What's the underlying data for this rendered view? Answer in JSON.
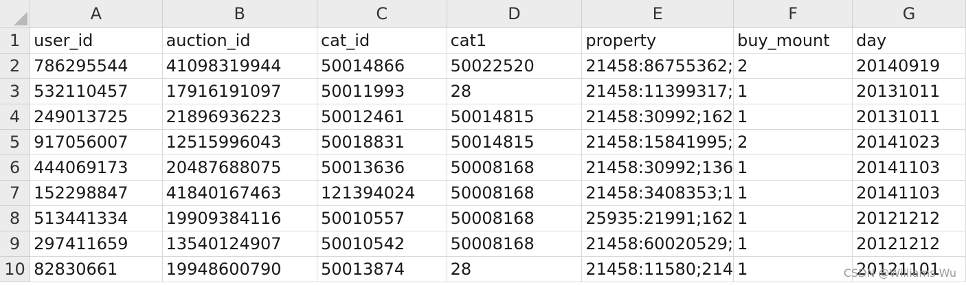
{
  "columns": [
    "A",
    "B",
    "C",
    "D",
    "E",
    "F",
    "G"
  ],
  "rows": [
    {
      "num": "1",
      "cells": [
        "user_id",
        "auction_id",
        "cat_id",
        "cat1",
        "property",
        "buy_mount",
        "day"
      ]
    },
    {
      "num": "2",
      "cells": [
        "786295544",
        "41098319944",
        "50014866",
        "50022520",
        "21458:86755362;",
        "2",
        "20140919"
      ]
    },
    {
      "num": "3",
      "cells": [
        "532110457",
        "17916191097",
        "50011993",
        "28",
        "21458:11399317;",
        "1",
        "20131011"
      ]
    },
    {
      "num": "4",
      "cells": [
        "249013725",
        "21896936223",
        "50012461",
        "50014815",
        "21458:30992;162",
        "1",
        "20131011"
      ]
    },
    {
      "num": "5",
      "cells": [
        "917056007",
        "12515996043",
        "50018831",
        "50014815",
        "21458:15841995;",
        "2",
        "20141023"
      ]
    },
    {
      "num": "6",
      "cells": [
        "444069173",
        "20487688075",
        "50013636",
        "50008168",
        "21458:30992;136",
        "1",
        "20141103"
      ]
    },
    {
      "num": "7",
      "cells": [
        "152298847",
        "41840167463",
        "121394024",
        "50008168",
        "21458:3408353;1",
        "1",
        "20141103"
      ]
    },
    {
      "num": "8",
      "cells": [
        "513441334",
        "19909384116",
        "50010557",
        "50008168",
        "25935:21991;162",
        "1",
        "20121212"
      ]
    },
    {
      "num": "9",
      "cells": [
        "297411659",
        "13540124907",
        "50010542",
        "50008168",
        "21458:60020529;",
        "1",
        "20121212"
      ]
    },
    {
      "num": "10",
      "cells": [
        "82830661",
        "19948600790",
        "50013874",
        "28",
        "21458:11580;214",
        "1",
        "20121101"
      ]
    }
  ],
  "watermark": "CSDN @Williams Wu"
}
